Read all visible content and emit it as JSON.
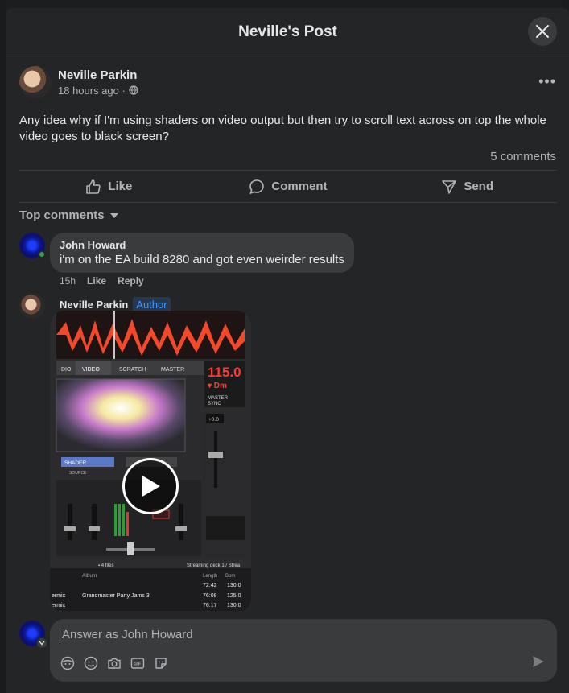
{
  "modal": {
    "title": "Neville's Post"
  },
  "post": {
    "author": "Neville Parkin",
    "time": "18 hours ago ·",
    "text": "Any idea why if I'm using shaders on video output but then try to scroll text across on top the whole video goes to black screen?",
    "comment_count": "5 comments"
  },
  "actions": {
    "like": "Like",
    "comment": "Comment",
    "send": "Send"
  },
  "sort": {
    "label": "Top comments"
  },
  "comments": [
    {
      "author": "John Howard",
      "text": "i'm on the EA build 8280 and got even weirder results",
      "time": "15h",
      "like": "Like",
      "reply": "Reply"
    },
    {
      "author": "Neville Parkin",
      "badge": "Author"
    }
  ],
  "video": {
    "bpm": "115.0",
    "key": "Dm",
    "tabs": [
      "DIO",
      "VIDEO",
      "SCRATCH",
      "MASTER"
    ],
    "shader_label": "SHADER",
    "source_label": "SOURCE",
    "pitch": "+0.0",
    "files_label": "4 files",
    "deck_label": "Streaming deck 1 / Strea",
    "col_album": "Album",
    "col_length": "Length",
    "col_bpm": "Bpm",
    "rows": [
      {
        "artist": "",
        "album": "",
        "length": "72:42",
        "bpm": "130.0"
      },
      {
        "artist": "ermix",
        "album": "Grandmaster Party Jams 3",
        "length": "76:08",
        "bpm": "125.0"
      },
      {
        "artist": "ermix",
        "album": "",
        "length": "76:17",
        "bpm": "130.0"
      }
    ]
  },
  "composer": {
    "placeholder": "Answer as John Howard"
  }
}
